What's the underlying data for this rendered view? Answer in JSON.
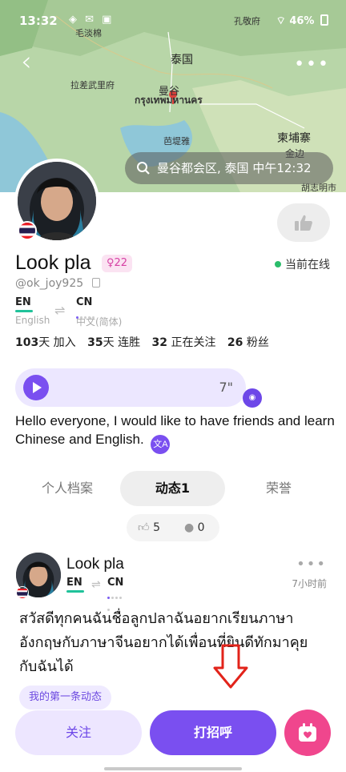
{
  "status_bar": {
    "time": "13:32",
    "battery": "46%"
  },
  "map": {
    "labels": [
      "泰国",
      "曼谷",
      "กรุงเทพมหานคร",
      "柬埔寨",
      "金边",
      "毛淡棉",
      "拉差武里府",
      "芭堤雅",
      "胡志明市",
      "孔敬府"
    ],
    "location": "曼谷都会区, 泰国",
    "local_time": "中午12:32"
  },
  "profile": {
    "name": "Look pla",
    "age": "22",
    "status": "当前在线",
    "username": "@ok_joy925",
    "native_language": {
      "code": "EN",
      "name": "English"
    },
    "learning_language": {
      "code": "CN",
      "name": "中文(简体)"
    },
    "stats": [
      {
        "value": "103",
        "label": "天 加入"
      },
      {
        "value": "35",
        "label": "天 连胜"
      },
      {
        "value": "32",
        "label": "正在关注"
      },
      {
        "value": "26",
        "label": "粉丝"
      }
    ],
    "voice_duration": "7\"",
    "bio": "Hello everyone, I would like to have friends and learn Chinese and English."
  },
  "tabs": [
    {
      "label": "个人档案"
    },
    {
      "label": "动态1"
    },
    {
      "label": "荣誉"
    }
  ],
  "moment_counts": {
    "likes": "5",
    "comments": "0"
  },
  "post": {
    "author": "Look pla",
    "native": "EN",
    "learning": "CN",
    "time": "7小时前",
    "text": "สวัสดีทุกคนฉันชื่อลูกปลาฉันอยากเรียนภาษาอังกฤษกับภาษาจีนอยากได้เพื่อนที่ยินดีทักมาคุยกับฉันได้",
    "tag": "我的第一条动态"
  },
  "actions": {
    "follow": "关注",
    "greet": "打招呼"
  },
  "colors": {
    "accent": "#7a4ff0",
    "gift": "#f0468d",
    "online": "#2bbd6b"
  }
}
